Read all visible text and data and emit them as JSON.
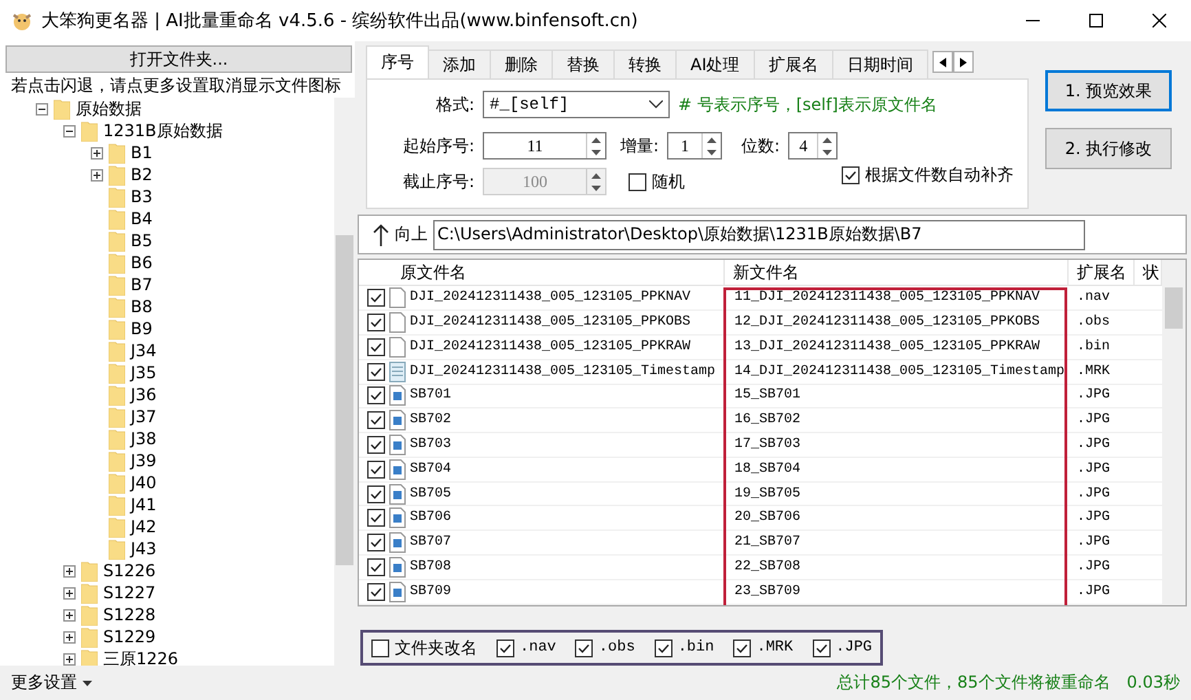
{
  "window": {
    "title": "大笨狗更名器 | AI批量重命名 v4.5.6 - 缤纷软件出品(www.binfensoft.cn)"
  },
  "sidebar": {
    "open_button": "打开文件夹...",
    "hint": "若点击闪退，请点更多设置取消显示文件图标",
    "tree": [
      {
        "label": "原始数据",
        "expanded": true,
        "children": [
          {
            "label": "1231B原始数据",
            "expanded": true,
            "children": [
              {
                "label": "B1",
                "expanded": false
              },
              {
                "label": "B2",
                "expanded": false
              },
              {
                "label": "B3"
              },
              {
                "label": "B4"
              },
              {
                "label": "B5"
              },
              {
                "label": "B6"
              },
              {
                "label": "B7"
              },
              {
                "label": "B8"
              },
              {
                "label": "B9"
              },
              {
                "label": "J34"
              },
              {
                "label": "J35"
              },
              {
                "label": "J36"
              },
              {
                "label": "J37"
              },
              {
                "label": "J38"
              },
              {
                "label": "J39"
              },
              {
                "label": "J40"
              },
              {
                "label": "J41"
              },
              {
                "label": "J42"
              },
              {
                "label": "J43"
              }
            ]
          },
          {
            "label": "S1226",
            "expanded": false
          },
          {
            "label": "S1227",
            "expanded": false
          },
          {
            "label": "S1228",
            "expanded": false
          },
          {
            "label": "S1229",
            "expanded": false
          },
          {
            "label": "三原1226",
            "expanded": false
          }
        ]
      }
    ],
    "more_settings": "更多设置"
  },
  "tabs": [
    {
      "label": "序号",
      "selected": true
    },
    {
      "label": "添加",
      "selected": false
    },
    {
      "label": "删除",
      "selected": false
    },
    {
      "label": "替换",
      "selected": false
    },
    {
      "label": "转换",
      "selected": false
    },
    {
      "label": "AI处理",
      "selected": false
    },
    {
      "label": "扩展名",
      "selected": false
    },
    {
      "label": "日期时间",
      "selected": false
    }
  ],
  "options": {
    "format_label": "格式:",
    "format_value": "#_[self]",
    "format_hint": "# 号表示序号，[self]表示原文件名",
    "start_label": "起始序号:",
    "start_value": "11",
    "step_label": "增量:",
    "step_value": "1",
    "digits_label": "位数:",
    "digits_value": "4",
    "end_label": "截止序号:",
    "end_value": "100",
    "end_disabled": true,
    "random": {
      "label": "随机",
      "checked": false
    },
    "autopad": {
      "label": "根据文件数自动补齐",
      "checked": true
    }
  },
  "actions": [
    {
      "label": "1. 预览效果",
      "selected": true
    },
    {
      "label": "2. 执行修改",
      "selected": false
    }
  ],
  "path_bar": {
    "up_label": "向上",
    "path": "C:\\Users\\Administrator\\Desktop\\原始数据\\1231B原始数据\\B7"
  },
  "table": {
    "columns": [
      "原文件名",
      "新文件名",
      "扩展名",
      "状"
    ],
    "rows": [
      {
        "checked": true,
        "kind": "file",
        "original": "DJI_202412311438_005_123105_PPKNAV",
        "new": "11_DJI_202412311438_005_123105_PPKNAV",
        "ext": ".nav"
      },
      {
        "checked": true,
        "kind": "file",
        "original": "DJI_202412311438_005_123105_PPKOBS",
        "new": "12_DJI_202412311438_005_123105_PPKOBS",
        "ext": ".obs"
      },
      {
        "checked": true,
        "kind": "file",
        "original": "DJI_202412311438_005_123105_PPKRAW",
        "new": "13_DJI_202412311438_005_123105_PPKRAW",
        "ext": ".bin"
      },
      {
        "checked": true,
        "kind": "text",
        "original": "DJI_202412311438_005_123105_Timestamp",
        "new": "14_DJI_202412311438_005_123105_Timestamp",
        "ext": ".MRK"
      },
      {
        "checked": true,
        "kind": "image",
        "original": "SB701",
        "new": "15_SB701",
        "ext": ".JPG"
      },
      {
        "checked": true,
        "kind": "image",
        "original": "SB702",
        "new": "16_SB702",
        "ext": ".JPG"
      },
      {
        "checked": true,
        "kind": "image",
        "original": "SB703",
        "new": "17_SB703",
        "ext": ".JPG"
      },
      {
        "checked": true,
        "kind": "image",
        "original": "SB704",
        "new": "18_SB704",
        "ext": ".JPG"
      },
      {
        "checked": true,
        "kind": "image",
        "original": "SB705",
        "new": "19_SB705",
        "ext": ".JPG"
      },
      {
        "checked": true,
        "kind": "image",
        "original": "SB706",
        "new": "20_SB706",
        "ext": ".JPG"
      },
      {
        "checked": true,
        "kind": "image",
        "original": "SB707",
        "new": "21_SB707",
        "ext": ".JPG"
      },
      {
        "checked": true,
        "kind": "image",
        "original": "SB708",
        "new": "22_SB708",
        "ext": ".JPG"
      },
      {
        "checked": true,
        "kind": "image",
        "original": "SB709",
        "new": "23_SB709",
        "ext": ".JPG"
      }
    ]
  },
  "filters": [
    {
      "label": "文件夹改名",
      "checked": false
    },
    {
      "label": ".nav",
      "checked": true
    },
    {
      "label": ".obs",
      "checked": true
    },
    {
      "label": ".bin",
      "checked": true
    },
    {
      "label": ".MRK",
      "checked": true
    },
    {
      "label": ".JPG",
      "checked": true
    }
  ],
  "status_bar": {
    "summary": "总计85个文件，85个文件将被重命名",
    "time": "0.03秒"
  }
}
